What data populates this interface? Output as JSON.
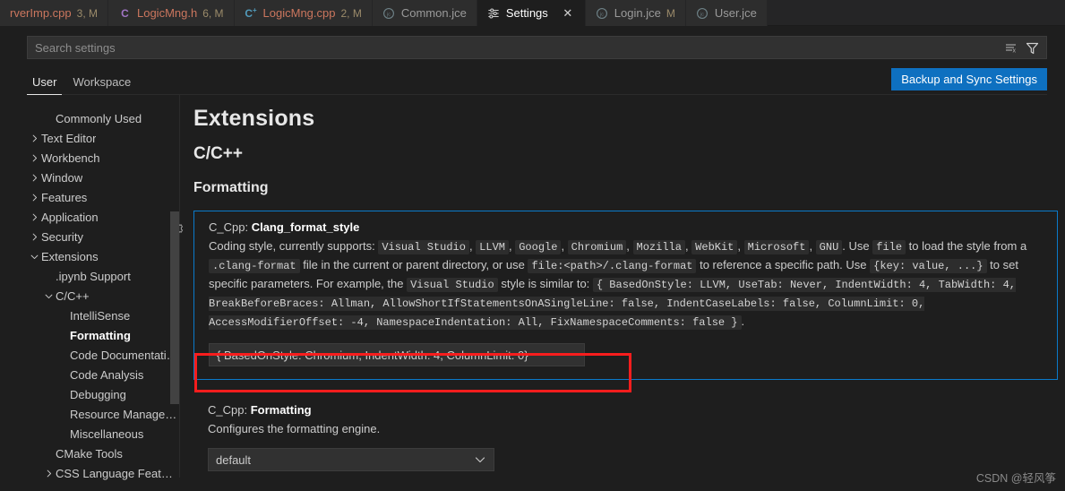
{
  "tabs": [
    {
      "name": "rverImp.cpp",
      "badge": "3, M",
      "icon": "cpp-file-icon",
      "active": false,
      "closable": false,
      "icon_color": "#9b7ad1",
      "truncated": true
    },
    {
      "name": "LogicMng.h",
      "badge": "6, M",
      "icon": "c-header-file-icon",
      "active": false,
      "closable": false,
      "icon_color": "#a074c4"
    },
    {
      "name": "LogicMng.cpp",
      "badge": "2, M",
      "icon": "cpp-file-icon",
      "active": false,
      "closable": false,
      "icon_color": "#519aba"
    },
    {
      "name": "Common.jce",
      "badge": "",
      "icon": "jce-file-icon",
      "active": false,
      "closable": false,
      "icon_color": "#6d8086"
    },
    {
      "name": "Settings",
      "badge": "",
      "icon": "settings-gear-icon",
      "active": true,
      "closable": true,
      "icon_color": "#cccccc"
    },
    {
      "name": "Login.jce",
      "badge": "M",
      "icon": "jce-file-icon",
      "active": false,
      "closable": false,
      "icon_color": "#6d8086"
    },
    {
      "name": "User.jce",
      "badge": "",
      "icon": "jce-file-icon",
      "active": false,
      "closable": false,
      "icon_color": "#6d8086"
    }
  ],
  "search": {
    "value": "",
    "placeholder": "Search settings",
    "clear_icon": "clear-filter-icon",
    "filter_icon": "filter-funnel-icon"
  },
  "subtabs": [
    {
      "label": "User",
      "active": true
    },
    {
      "label": "Workspace",
      "active": false
    }
  ],
  "sync_button": {
    "label": "Backup and Sync Settings"
  },
  "sidebar": {
    "items": [
      {
        "label": "Commonly Used",
        "indent": 1,
        "twisty": "none",
        "selected": false
      },
      {
        "label": "Text Editor",
        "indent": 0,
        "twisty": "collapsed",
        "selected": false
      },
      {
        "label": "Workbench",
        "indent": 0,
        "twisty": "collapsed",
        "selected": false
      },
      {
        "label": "Window",
        "indent": 0,
        "twisty": "collapsed",
        "selected": false
      },
      {
        "label": "Features",
        "indent": 0,
        "twisty": "collapsed",
        "selected": false
      },
      {
        "label": "Application",
        "indent": 0,
        "twisty": "collapsed",
        "selected": false
      },
      {
        "label": "Security",
        "indent": 0,
        "twisty": "collapsed",
        "selected": false
      },
      {
        "label": "Extensions",
        "indent": 0,
        "twisty": "expanded",
        "selected": false
      },
      {
        "label": ".ipynb Support",
        "indent": 1,
        "twisty": "none",
        "selected": false
      },
      {
        "label": "C/C++",
        "indent": 1,
        "twisty": "expanded",
        "selected": false
      },
      {
        "label": "IntelliSense",
        "indent": 2,
        "twisty": "none",
        "selected": false
      },
      {
        "label": "Formatting",
        "indent": 2,
        "twisty": "none",
        "selected": true
      },
      {
        "label": "Code Documentation",
        "indent": 2,
        "twisty": "none",
        "selected": false
      },
      {
        "label": "Code Analysis",
        "indent": 2,
        "twisty": "none",
        "selected": false
      },
      {
        "label": "Debugging",
        "indent": 2,
        "twisty": "none",
        "selected": false
      },
      {
        "label": "Resource Manageme...",
        "indent": 2,
        "twisty": "none",
        "selected": false
      },
      {
        "label": "Miscellaneous",
        "indent": 2,
        "twisty": "none",
        "selected": false
      },
      {
        "label": "CMake Tools",
        "indent": 1,
        "twisty": "none",
        "selected": false
      },
      {
        "label": "CSS Language Features",
        "indent": 1,
        "twisty": "collapsed",
        "selected": false
      }
    ]
  },
  "main": {
    "heading": "Extensions",
    "subheading": "C/C++",
    "section": "Formatting",
    "settings": [
      {
        "prefix": "C_Cpp: ",
        "title": "Clang_format_style",
        "gear_icon": "gear-icon",
        "desc_parts": [
          {
            "t": "Coding style, currently supports: ",
            "code": false
          },
          {
            "t": "Visual Studio",
            "code": true
          },
          {
            "t": ", ",
            "code": false
          },
          {
            "t": "LLVM",
            "code": true
          },
          {
            "t": ", ",
            "code": false
          },
          {
            "t": "Google",
            "code": true
          },
          {
            "t": ", ",
            "code": false
          },
          {
            "t": "Chromium",
            "code": true
          },
          {
            "t": ", ",
            "code": false
          },
          {
            "t": "Mozilla",
            "code": true
          },
          {
            "t": ", ",
            "code": false
          },
          {
            "t": "WebKit",
            "code": true
          },
          {
            "t": ", ",
            "code": false
          },
          {
            "t": "Microsoft",
            "code": true
          },
          {
            "t": ", ",
            "code": false
          },
          {
            "t": "GNU",
            "code": true
          },
          {
            "t": ". Use ",
            "code": false
          },
          {
            "t": "file",
            "code": true
          },
          {
            "t": " to load the style from a ",
            "code": false
          },
          {
            "t": ".clang-format",
            "code": true
          },
          {
            "t": " file in the current or parent directory, or use ",
            "code": false
          },
          {
            "t": "file:<path>/.clang-format",
            "code": true
          },
          {
            "t": " to reference a specific path. Use ",
            "code": false
          },
          {
            "t": "{key: value, ...}",
            "code": true
          },
          {
            "t": " to set specific parameters. For example, the ",
            "code": false
          },
          {
            "t": "Visual Studio",
            "code": true
          },
          {
            "t": " style is similar to: ",
            "code": false
          },
          {
            "t": "{ BasedOnStyle: LLVM, UseTab: Never, IndentWidth: 4, TabWidth: 4, BreakBeforeBraces: Allman, AllowShortIfStatementsOnASingleLine: false, IndentCaseLabels: false, ColumnLimit: 0, AccessModifierOffset: -4, NamespaceIndentation: All, FixNamespaceComments: false }",
            "code": true
          },
          {
            "t": ".",
            "code": false
          }
        ],
        "input_value": "{ BasedOnStyle: Chromium, IndentWidth: 4, ColumnLimit: 0}",
        "input_placeholder": ""
      },
      {
        "prefix": "C_Cpp: ",
        "title": "Formatting",
        "gear_icon": "gear-icon",
        "description": "Configures the formatting engine.",
        "select_value": "default",
        "chevron_icon": "chevron-down-icon"
      }
    ]
  },
  "watermark": "CSDN @轻风筝",
  "colors": {
    "accent_blue": "#0e70c0",
    "focus_border": "#0a7aca",
    "annotation_red": "#f81d1d",
    "editor_bg": "#1e1e1e",
    "tabbar_bg": "#252526"
  }
}
